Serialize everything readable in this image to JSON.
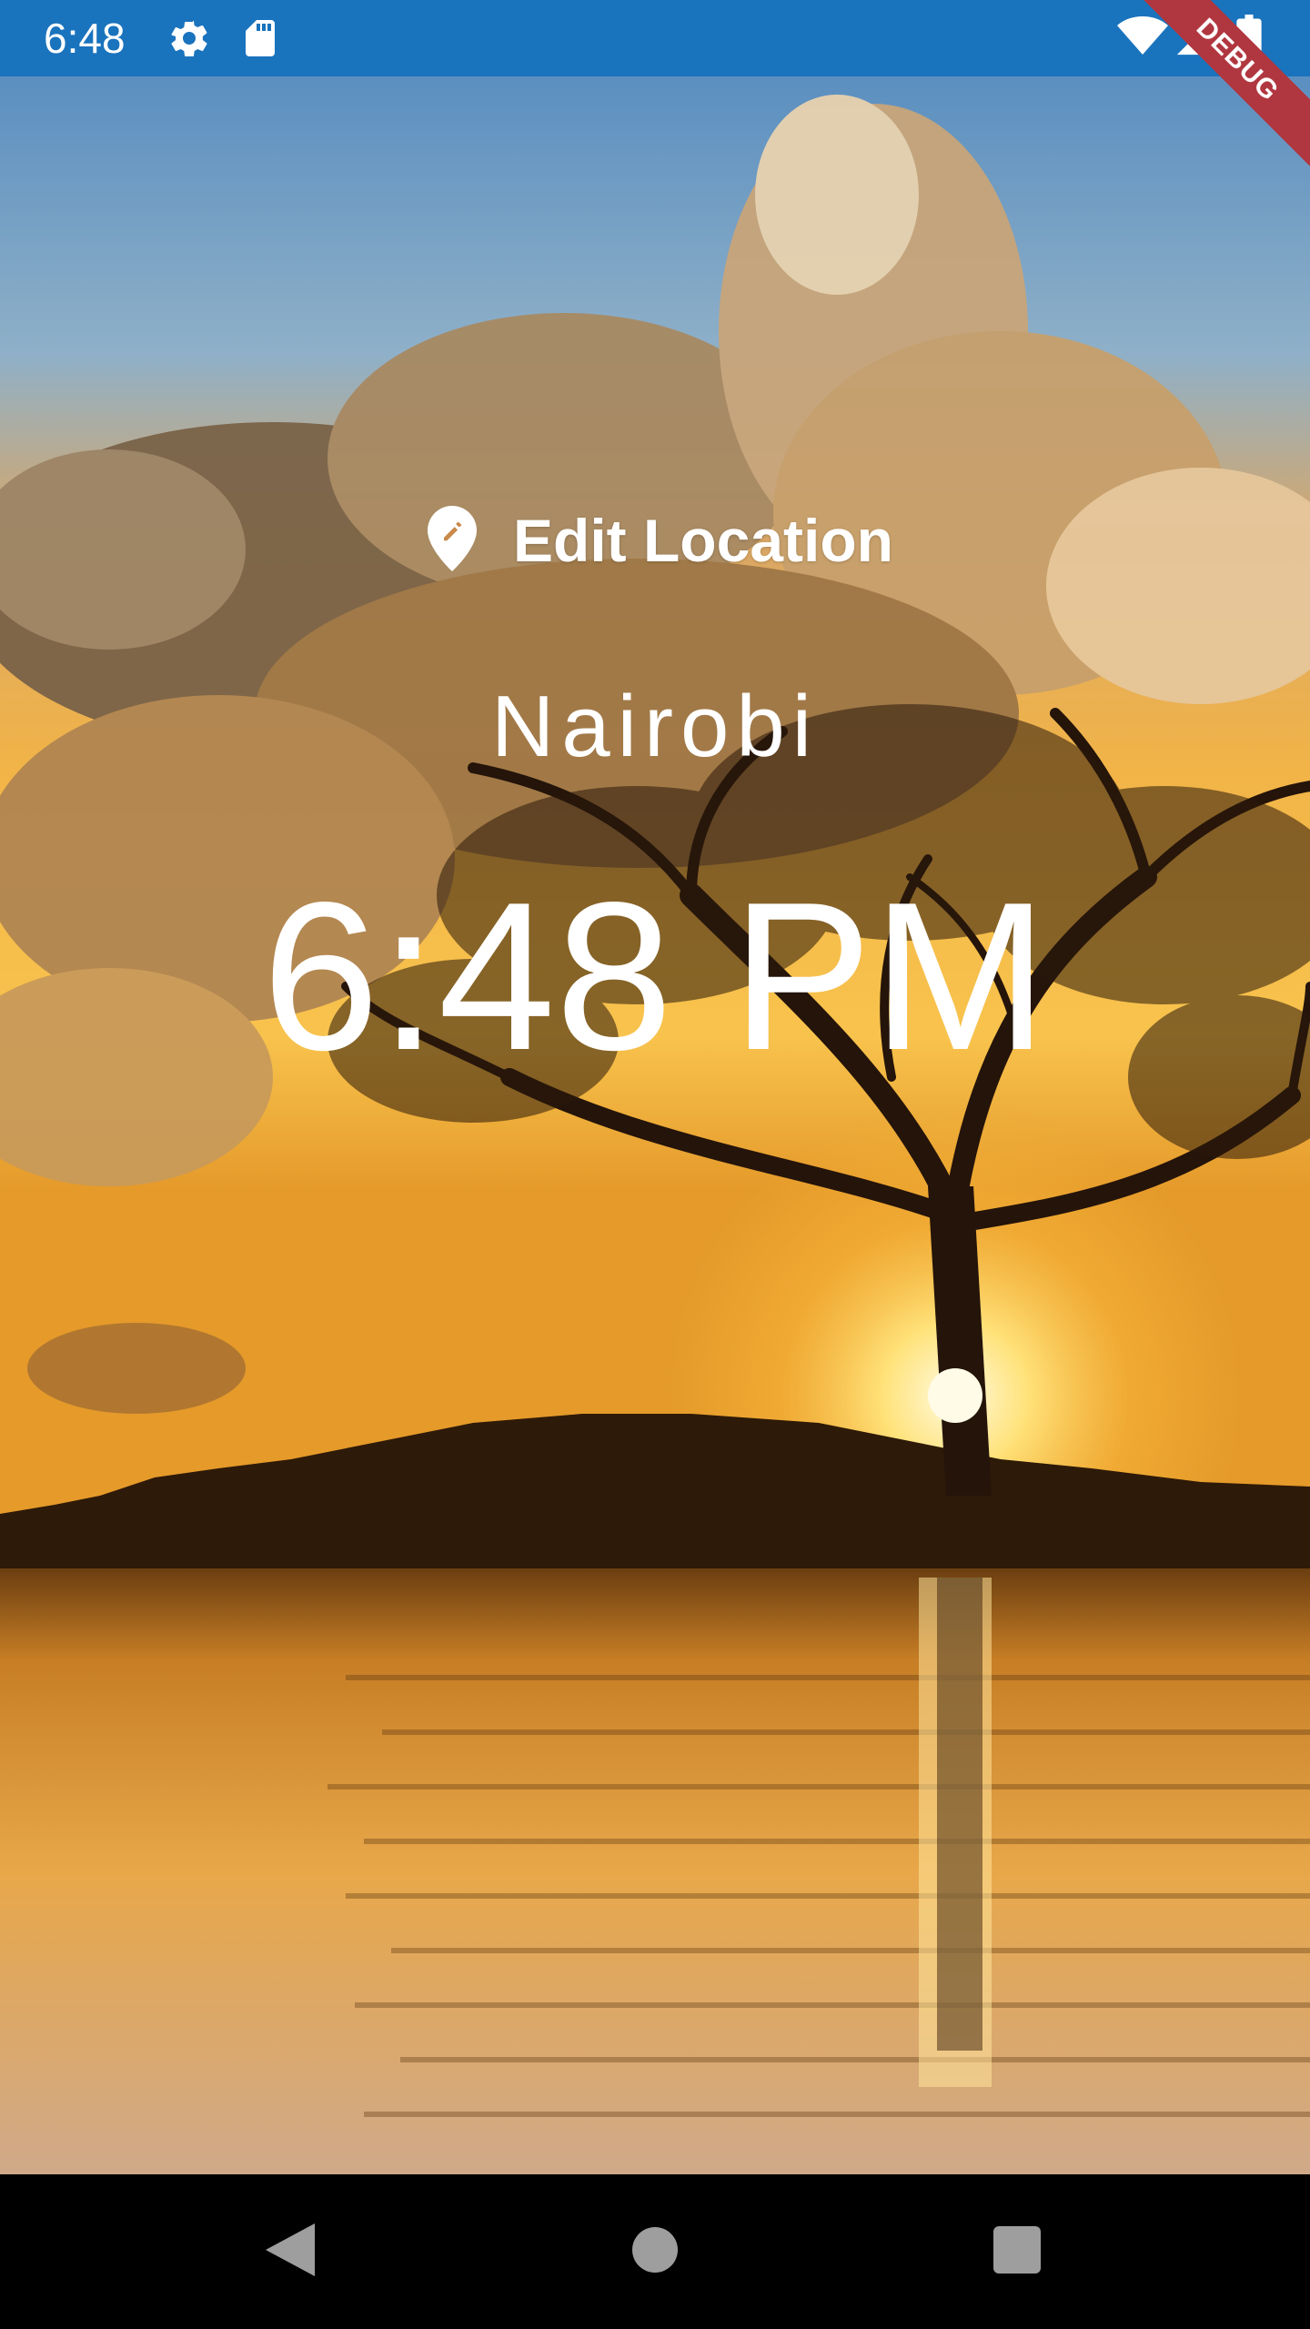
{
  "status_bar": {
    "time": "6:48",
    "icons": [
      "settings-icon",
      "sd-card-icon",
      "wifi-icon",
      "signal-icon",
      "battery-icon"
    ],
    "background": "#1a73bd"
  },
  "debug_banner": {
    "label": "DEBUG",
    "color": "#b0363f"
  },
  "main": {
    "edit_location_label": "Edit Location",
    "edit_location_icon": "location-edit-icon",
    "location": "Nairobi",
    "time": "6:48 PM",
    "background_image": "sunset-tree-lake"
  },
  "nav_bar": {
    "buttons": [
      "back-icon",
      "home-icon",
      "recents-icon"
    ]
  }
}
